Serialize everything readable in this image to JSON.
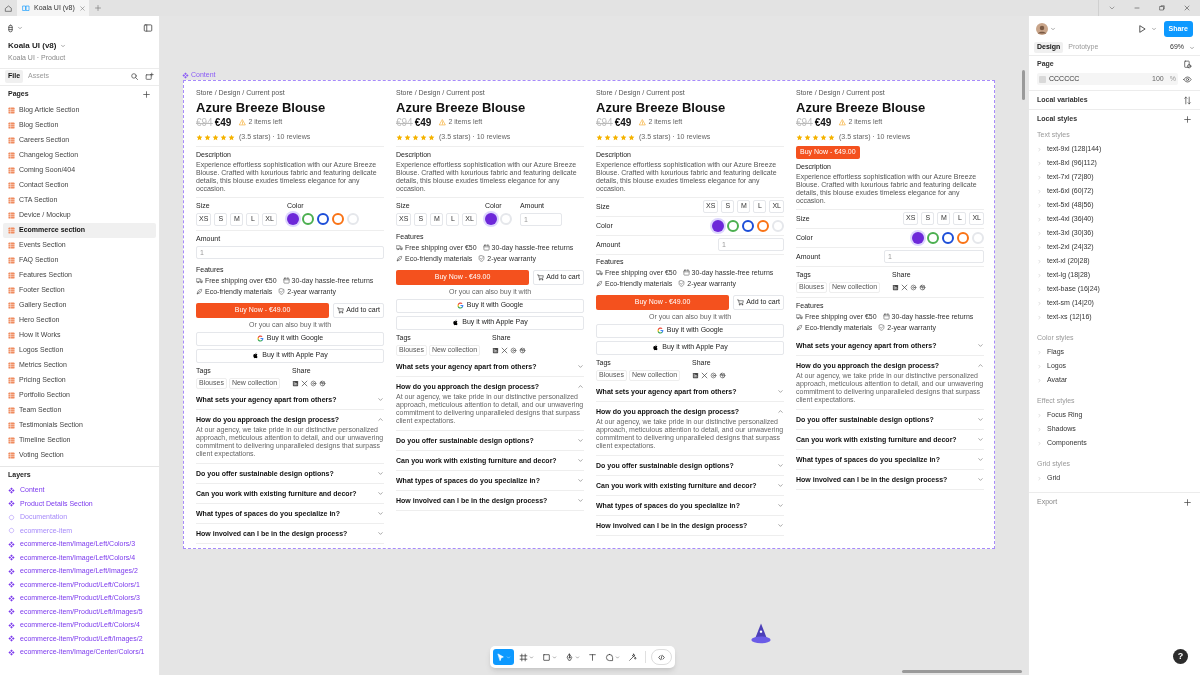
{
  "tabs": [
    {
      "label": "Koala UI (v8)",
      "selected": true
    }
  ],
  "left_panel": {
    "file_name": "Koala UI (v8)",
    "file_path": "Koala UI · Product",
    "tabs": [
      {
        "label": "File",
        "selected": true
      },
      {
        "label": "Assets",
        "selected": false
      }
    ],
    "pages_label": "Pages",
    "pages": [
      {
        "label": "Blog Article Section",
        "selected": false
      },
      {
        "label": "Blog Section",
        "selected": false
      },
      {
        "label": "Careers Section",
        "selected": false
      },
      {
        "label": "Changelog Section",
        "selected": false
      },
      {
        "label": "Coming Soon/404",
        "selected": false
      },
      {
        "label": "Contact Section",
        "selected": false
      },
      {
        "label": "CTA Section",
        "selected": false
      },
      {
        "label": "Device / Mockup",
        "selected": false
      },
      {
        "label": "Ecommerce section",
        "selected": true
      },
      {
        "label": "Events Section",
        "selected": false
      },
      {
        "label": "FAQ Section",
        "selected": false
      },
      {
        "label": "Features Section",
        "selected": false
      },
      {
        "label": "Footer Section",
        "selected": false
      },
      {
        "label": "Gallery Section",
        "selected": false
      },
      {
        "label": "Hero Section",
        "selected": false
      },
      {
        "label": "How It Works",
        "selected": false
      },
      {
        "label": "Logos Section",
        "selected": false
      },
      {
        "label": "Metrics Section",
        "selected": false
      },
      {
        "label": "Pricing Section",
        "selected": false
      },
      {
        "label": "Portfolio Section",
        "selected": false
      },
      {
        "label": "Team Section",
        "selected": false
      },
      {
        "label": "Testimonials Section",
        "selected": false
      },
      {
        "label": "Timeline Section",
        "selected": false
      },
      {
        "label": "Voting Section",
        "selected": false
      }
    ],
    "layers_label": "Layers",
    "layers": [
      {
        "label": "Content",
        "kind": "component"
      },
      {
        "label": "Product Details Section",
        "kind": "component"
      },
      {
        "label": "Documentation",
        "kind": "outline"
      },
      {
        "label": "ecommerce-item",
        "kind": "outline"
      },
      {
        "label": "ecommerce-item/Image/Left/Colors/3",
        "kind": "component"
      },
      {
        "label": "ecommerce-item/Image/Left/Colors/4",
        "kind": "component"
      },
      {
        "label": "ecommerce-item/Image/Left/Images/2",
        "kind": "component"
      },
      {
        "label": "ecommerce-item/Product/Left/Colors/1",
        "kind": "component"
      },
      {
        "label": "ecommerce-item/Product/Left/Colors/3",
        "kind": "component"
      },
      {
        "label": "ecommerce-item/Product/Left/Images/5",
        "kind": "component"
      },
      {
        "label": "ecommerce-item/Product/Left/Colors/4",
        "kind": "component"
      },
      {
        "label": "ecommerce-item/Product/Left/Images/2",
        "kind": "component"
      },
      {
        "label": "ecommerce-item/Image/Center/Colors/1",
        "kind": "component"
      }
    ]
  },
  "canvas": {
    "frame_label": "Content",
    "products": [
      {
        "kind": "inline",
        "breadcrumb": "Store / Design / Current post",
        "title": "Azure Breeze Blouse",
        "old_price": "€94",
        "price": "€49",
        "stock": "2 items left",
        "stars": 5,
        "rating": "(3.5 stars) · 10 reviews",
        "description_label": "Description",
        "description": "Experience effortless sophistication with our Azure Breeze Blouse. Crafted with luxurious fabric and featuring delicate details, this blouse exudes timeless elegance for any occasion.",
        "size_label": "Size",
        "sizes": [
          "XS",
          "S",
          "M",
          "L",
          "XL"
        ],
        "color_label": "Color",
        "colors": [
          {
            "color": "#6d28d9",
            "selected": true
          },
          {
            "color": "#4caf50",
            "selected": false
          },
          {
            "color": "#1d4ed8",
            "selected": false
          },
          {
            "color": "#f97316",
            "selected": false
          },
          {
            "color": "#e5e7eb",
            "selected": false
          }
        ],
        "amount_label": "Amount",
        "amount_placeholder": "1",
        "features_label": "Features",
        "features": [
          "Free shipping over €50",
          "30-day hassle-free returns",
          "Eco-friendly materials",
          "2-year warranty"
        ],
        "buy": "Buy Now - €49.00",
        "add_to_cart": "Add to cart",
        "alt_pay": "Or you can also buy it with",
        "google": "Buy it with Google",
        "apple": "Buy it with Apple Pay",
        "tags_label": "Tags",
        "tags": [
          "Blouses",
          "New collection"
        ],
        "share_label": "Share",
        "faq": [
          {
            "question": "What sets your agency apart from others?",
            "expanded": false
          },
          {
            "question": "How do you approach the design process?",
            "expanded": true,
            "answer": "At our agency, we take pride in our distinctive personalized approach, meticulous attention to detail, and our unwavering commitment to delivering unparalleled designs that surpass client expectations."
          },
          {
            "question": "Do you offer sustainable design options?",
            "expanded": false
          },
          {
            "question": "Can you work with existing furniture and decor?",
            "expanded": false
          },
          {
            "question": "What types of spaces do you specialize in?",
            "expanded": false
          },
          {
            "question": "How involved can I be in the design process?",
            "expanded": false
          }
        ]
      },
      {
        "kind": "columns",
        "breadcrumb": "Store / Design / Current post",
        "title": "Azure Breeze Blouse",
        "old_price": "€94",
        "price": "€49",
        "stock": "2 items left",
        "stars": 5,
        "rating": "(3.5 stars) · 10 reviews",
        "description_label": "Description",
        "description": "Experience effortless sophistication with our Azure Breeze Blouse. Crafted with luxurious fabric and featuring delicate details, this blouse exudes timeless elegance for any occasion.",
        "size_label": "Size",
        "sizes": [
          "XS",
          "S",
          "M",
          "L",
          "XL"
        ],
        "color_label": "Color",
        "colors": [
          {
            "color": "#6d28d9",
            "selected": true
          },
          {
            "color": "#e5e7eb",
            "selected": false
          }
        ],
        "amount_label": "Amount",
        "amount_placeholder": "1",
        "features_label": "Features",
        "features": [
          "Free shipping over €50",
          "30-day hassle-free returns",
          "Eco-friendly materials",
          "2-year warranty"
        ],
        "buy": "Buy Now - €49.00",
        "add_to_cart": "Add to cart",
        "alt_pay": "Or you can also buy it with",
        "google": "Buy it with Google",
        "apple": "Buy it with Apple Pay",
        "tags_label": "Tags",
        "tags": [
          "Blouses",
          "New collection"
        ],
        "share_label": "Share",
        "faq": [
          {
            "question": "What sets your agency apart from others?",
            "expanded": false
          },
          {
            "question": "How do you approach the design process?",
            "expanded": true,
            "answer": "At our agency, we take pride in our distinctive personalized approach, meticulous attention to detail, and our unwavering commitment to delivering unparalleled designs that surpass client expectations."
          },
          {
            "question": "Do you offer sustainable design options?",
            "expanded": false
          },
          {
            "question": "Can you work with existing furniture and decor?",
            "expanded": false
          },
          {
            "question": "What types of spaces do you specialize in?",
            "expanded": false
          },
          {
            "question": "How involved can I be in the design process?",
            "expanded": false
          }
        ]
      },
      {
        "kind": "rows",
        "breadcrumb": "Store / Design / Current post",
        "title": "Azure Breeze Blouse",
        "old_price": "€94",
        "price": "€49",
        "stock": "2 items left",
        "stars": 5,
        "rating": "(3.5 stars) · 10 reviews",
        "description_label": "Description",
        "description": "Experience effortless sophistication with our Azure Breeze Blouse. Crafted with luxurious fabric and featuring delicate details, this blouse exudes timeless elegance for any occasion.",
        "size_label": "Size",
        "sizes": [
          "XS",
          "S",
          "M",
          "L",
          "XL"
        ],
        "color_label": "Color",
        "colors": [
          {
            "color": "#6d28d9",
            "selected": true
          },
          {
            "color": "#4caf50",
            "selected": false
          },
          {
            "color": "#1d4ed8",
            "selected": false
          },
          {
            "color": "#f97316",
            "selected": false
          },
          {
            "color": "#e5e7eb",
            "selected": false
          }
        ],
        "amount_label": "Amount",
        "amount_placeholder": "1",
        "features_label": "Features",
        "features": [
          "Free shipping over €50",
          "30-day hassle-free returns",
          "Eco-friendly materials",
          "2-year warranty"
        ],
        "buy": "Buy Now - €49.00",
        "add_to_cart": "Add to cart",
        "alt_pay": "Or you can also buy it with",
        "google": "Buy it with Google",
        "apple": "Buy it with Apple Pay",
        "tags_label": "Tags",
        "tags": [
          "Blouses",
          "New collection"
        ],
        "share_label": "Share",
        "faq": [
          {
            "question": "What sets your agency apart from others?",
            "expanded": false
          },
          {
            "question": "How do you approach the design process?",
            "expanded": true,
            "answer": "At our agency, we take pride in our distinctive personalized approach, meticulous attention to detail, and our unwavering commitment to delivering unparalleled designs that surpass client expectations."
          },
          {
            "question": "Do you offer sustainable design options?",
            "expanded": false
          },
          {
            "question": "Can you work with existing furniture and decor?",
            "expanded": false
          },
          {
            "question": "What types of spaces do you specialize in?",
            "expanded": false
          },
          {
            "question": "How involved can I be in the design process?",
            "expanded": false
          }
        ]
      },
      {
        "kind": "compact",
        "breadcrumb": "Store / Design / Current post",
        "title": "Azure Breeze Blouse",
        "old_price": "€94",
        "price": "€49",
        "stock": "2 items left",
        "stars": 5,
        "rating": "(3.5 stars) · 10 reviews",
        "buy": "Buy Now - €49.00",
        "description_label": "Description",
        "description": "Experience effortless sophistication with our Azure Breeze Blouse. Crafted with luxurious fabric and featuring delicate details, this blouse exudes timeless elegance for any occasion.",
        "size_label": "Size",
        "sizes": [
          "XS",
          "S",
          "M",
          "L",
          "XL"
        ],
        "color_label": "Color",
        "colors": [
          {
            "color": "#6d28d9",
            "selected": true
          },
          {
            "color": "#4caf50",
            "selected": false
          },
          {
            "color": "#1d4ed8",
            "selected": false
          },
          {
            "color": "#f97316",
            "selected": false
          },
          {
            "color": "#e5e7eb",
            "selected": false
          }
        ],
        "amount_label": "Amount",
        "amount_placeholder": "1",
        "tags_label": "Tags",
        "tags": [
          "Blouses",
          "New collection"
        ],
        "share_label": "Share",
        "features_label": "Features",
        "features": [
          "Free shipping over €50",
          "30-day hassle-free returns",
          "Eco-friendly materials",
          "2-year warranty"
        ],
        "faq": [
          {
            "question": "What sets your agency apart from others?",
            "expanded": false
          },
          {
            "question": "How do you approach the design process?",
            "expanded": true,
            "answer": "At our agency, we take pride in our distinctive personalized approach, meticulous attention to detail, and our unwavering commitment to delivering unparalleled designs that surpass client expectations."
          },
          {
            "question": "Do you offer sustainable design options?",
            "expanded": false
          },
          {
            "question": "Can you work with existing furniture and decor?",
            "expanded": false
          },
          {
            "question": "What types of spaces do you specialize in?",
            "expanded": false
          },
          {
            "question": "How involved can I be in the design process?",
            "expanded": false
          }
        ]
      }
    ]
  },
  "toolbar": {
    "tools": [
      {
        "kind": "move",
        "selected": true,
        "has_menu": true
      },
      {
        "kind": "frame",
        "selected": false,
        "has_menu": true
      },
      {
        "kind": "rectangle",
        "selected": false,
        "has_menu": true
      },
      {
        "kind": "pen",
        "selected": false,
        "has_menu": true
      },
      {
        "kind": "text",
        "selected": false,
        "has_menu": false
      },
      {
        "kind": "comment",
        "selected": false,
        "has_menu": true
      },
      {
        "kind": "actions",
        "selected": false,
        "has_menu": false
      },
      {
        "kind": "code",
        "selected": false,
        "has_menu": false
      }
    ]
  },
  "right_panel": {
    "share": "Share",
    "tabs": [
      {
        "label": "Design",
        "selected": true
      },
      {
        "label": "Prototype",
        "selected": false
      }
    ],
    "zoom": "69%",
    "page_label": "Page",
    "page_color": "CCCCCC",
    "page_opacity": "100",
    "page_unit": "%",
    "local_variables": "Local variables",
    "local_styles": "Local styles",
    "style_groups": [
      {
        "label": "Text styles",
        "items": [
          "text-9xl (128|144)",
          "text-8xl (96|112)",
          "text-7xl (72|80)",
          "text-6xl (60|72)",
          "text-5xl (48|56)",
          "text-4xl (36|40)",
          "text-3xl (30|36)",
          "text-2xl (24|32)",
          "text-xl (20|28)",
          "text-lg (18|28)",
          "text-base (16|24)",
          "text-sm (14|20)",
          "text-xs (12|16)"
        ]
      },
      {
        "label": "Color styles",
        "items": [
          "Flags",
          "Logos",
          "Avatar"
        ]
      },
      {
        "label": "Effect styles",
        "items": [
          "Focus Ring",
          "Shadows",
          "Components"
        ]
      },
      {
        "label": "Grid styles",
        "items": [
          "Grid"
        ]
      }
    ],
    "export": "Export"
  },
  "help": "?"
}
